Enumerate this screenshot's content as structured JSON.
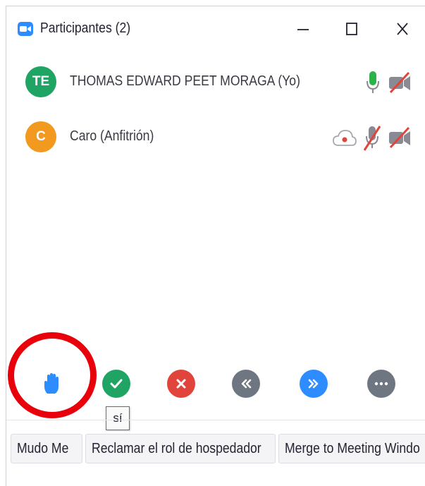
{
  "window": {
    "title": "Participantes (2)",
    "icon": "zoom-camera-icon",
    "controls": [
      "minimize-icon",
      "maximize-icon",
      "close-icon"
    ]
  },
  "participants": [
    {
      "initials": "TE",
      "name": "THOMAS EDWARD PEET MORAGA (Yo)",
      "avatar_color": "#1fa463",
      "mic": "on",
      "video": "off"
    },
    {
      "initials": "C",
      "name": "Caro (Anfitrión)",
      "avatar_color": "#f29a1f",
      "mic": "muted",
      "video": "off",
      "extra_icon": "cloud-record-icon"
    }
  ],
  "actions": {
    "items": [
      "raise-hand-icon",
      "yes-icon",
      "no-icon",
      "slower-icon",
      "faster-icon",
      "more-icon"
    ],
    "tooltip": "sí"
  },
  "bottom_buttons": {
    "mute_me": "Mudo Me",
    "claim_host": "Reclamar el rol de hospedador",
    "merge": "Merge to Meeting Windo"
  },
  "colors": {
    "accent": "#2D8CFF",
    "green": "#1fa463",
    "red": "#e0443a",
    "highlight": "#e8000b"
  }
}
